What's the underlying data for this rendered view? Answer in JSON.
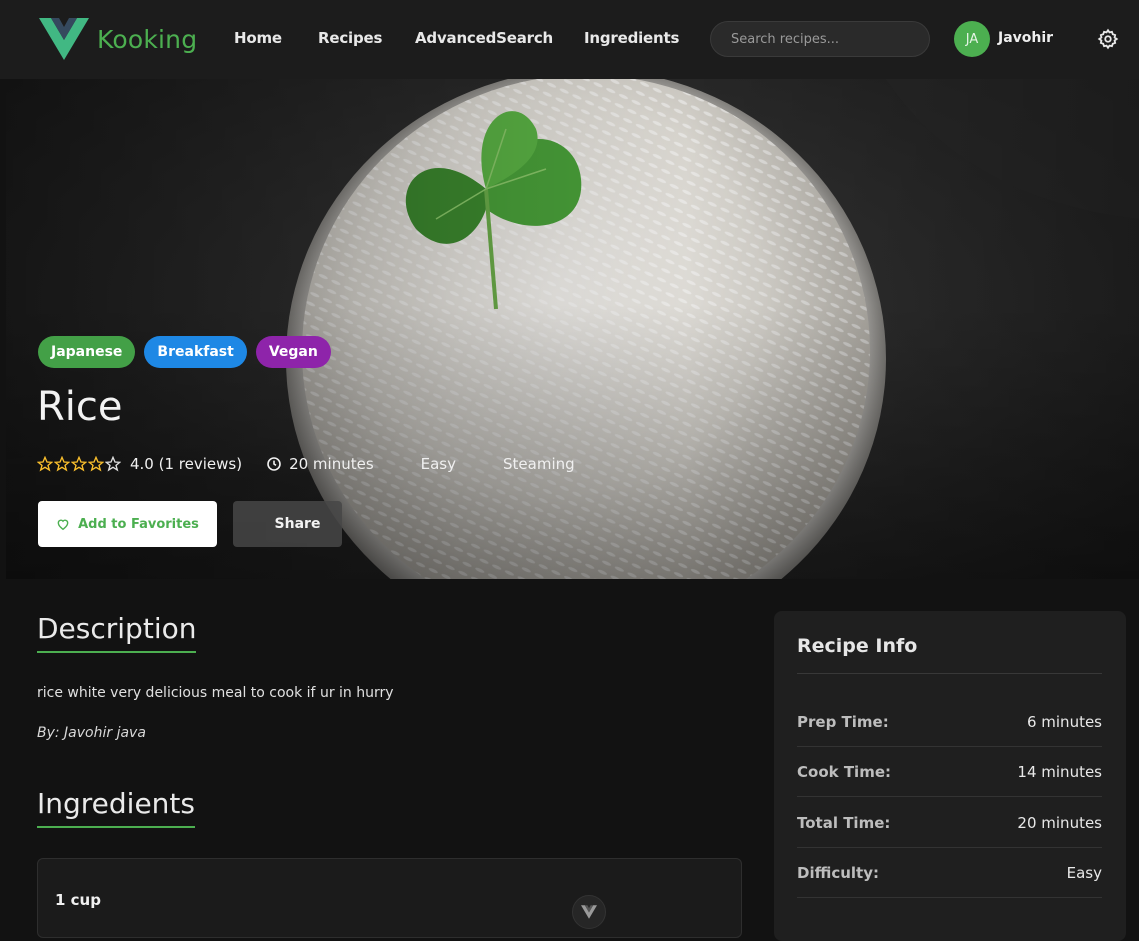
{
  "brand": {
    "name": "Kooking",
    "accent": "#4caf50"
  },
  "nav": {
    "links": [
      "Home",
      "Recipes",
      "AdvancedSearch",
      "Ingredients"
    ],
    "search_placeholder": "Search recipes...",
    "user_initials": "JA",
    "user_name": "Javohir"
  },
  "recipe": {
    "tags": [
      {
        "label": "Japanese",
        "color": "#43a047"
      },
      {
        "label": "Breakfast",
        "color": "#1e88e5"
      },
      {
        "label": "Vegan",
        "color": "#8e24aa"
      }
    ],
    "title": "Rice",
    "rating": 4.0,
    "rating_text": "4.0 (1 reviews)",
    "time": "20 minutes",
    "difficulty": "Easy",
    "method": "Steaming",
    "favorite_label": "Add to Favorites",
    "share_label": "Share"
  },
  "main": {
    "description_heading": "Description",
    "description": "rice white very delicious meal to cook if ur in hurry",
    "author": "By: Javohir java",
    "ingredients_heading": "Ingredients",
    "ingredients": [
      {
        "quantity": "1 cup"
      }
    ]
  },
  "info": {
    "title": "Recipe Info",
    "rows": [
      {
        "label": "Prep Time:",
        "value": "6 minutes"
      },
      {
        "label": "Cook Time:",
        "value": "14 minutes"
      },
      {
        "label": "Total Time:",
        "value": "20 minutes"
      },
      {
        "label": "Difficulty:",
        "value": "Easy"
      }
    ]
  }
}
